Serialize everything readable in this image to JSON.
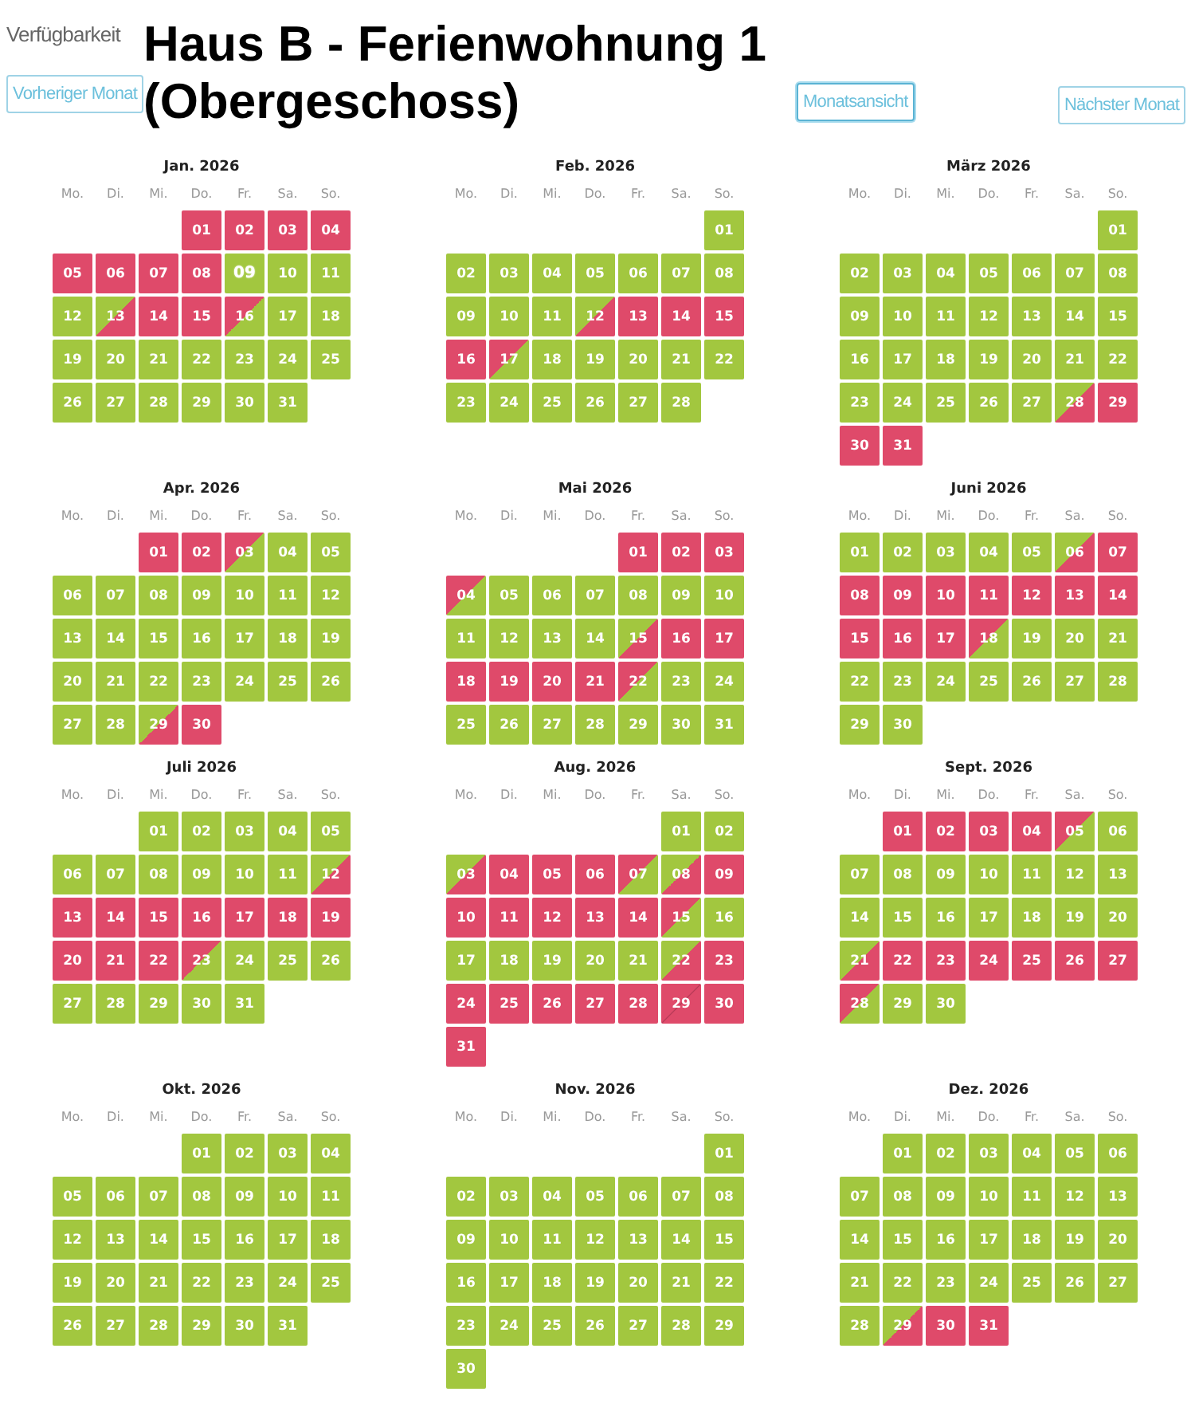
{
  "header": {
    "section_label": "Verfügbarkeit",
    "title": "Haus B - Ferienwohnung 1 (Obergeschoss)",
    "buttons": [
      {
        "label": "Vorheriger Monat",
        "selected": false
      },
      {
        "label": "Monatsansicht",
        "selected": true
      },
      {
        "label": "Nächster Monat",
        "selected": false
      }
    ]
  },
  "months": [
    {
      "title": "Jan. 2026",
      "weekdays": [
        "Mo.",
        "Di.",
        "Mi.",
        "Do.",
        "Fr.",
        "Sa.",
        "So."
      ],
      "cells": [
        null,
        null,
        null,
        {
          "day": "01",
          "kind": "booked",
          "today": false
        },
        {
          "day": "02",
          "kind": "booked",
          "today": false
        },
        {
          "day": "03",
          "kind": "booked",
          "today": false
        },
        {
          "day": "04",
          "kind": "booked",
          "today": false
        },
        {
          "day": "05",
          "kind": "booked",
          "today": false
        },
        {
          "day": "06",
          "kind": "booked",
          "today": false
        },
        {
          "day": "07",
          "kind": "booked",
          "today": false
        },
        {
          "day": "08",
          "kind": "booked",
          "today": false
        },
        {
          "day": "09",
          "kind": "free",
          "today": true
        },
        {
          "day": "10",
          "kind": "free",
          "today": false
        },
        {
          "day": "11",
          "kind": "free",
          "today": false
        },
        {
          "day": "12",
          "kind": "free",
          "today": false
        },
        {
          "day": "13",
          "kind": "arrival",
          "today": false
        },
        {
          "day": "14",
          "kind": "booked",
          "today": false
        },
        {
          "day": "15",
          "kind": "booked",
          "today": false
        },
        {
          "day": "16",
          "kind": "departure",
          "today": false
        },
        {
          "day": "17",
          "kind": "free",
          "today": false
        },
        {
          "day": "18",
          "kind": "free",
          "today": false
        },
        {
          "day": "19",
          "kind": "free",
          "today": false
        },
        {
          "day": "20",
          "kind": "free",
          "today": false
        },
        {
          "day": "21",
          "kind": "free",
          "today": false
        },
        {
          "day": "22",
          "kind": "free",
          "today": false
        },
        {
          "day": "23",
          "kind": "free",
          "today": false
        },
        {
          "day": "24",
          "kind": "free",
          "today": false
        },
        {
          "day": "25",
          "kind": "free",
          "today": false
        },
        {
          "day": "26",
          "kind": "free",
          "today": false
        },
        {
          "day": "27",
          "kind": "free",
          "today": false
        },
        {
          "day": "28",
          "kind": "free",
          "today": false
        },
        {
          "day": "29",
          "kind": "free",
          "today": false
        },
        {
          "day": "30",
          "kind": "free",
          "today": false
        },
        {
          "day": "31",
          "kind": "free",
          "today": false
        }
      ]
    },
    {
      "title": "Feb. 2026",
      "weekdays": [
        "Mo.",
        "Di.",
        "Mi.",
        "Do.",
        "Fr.",
        "Sa.",
        "So."
      ],
      "cells": [
        null,
        null,
        null,
        null,
        null,
        null,
        {
          "day": "01",
          "kind": "free",
          "today": false
        },
        {
          "day": "02",
          "kind": "free",
          "today": false
        },
        {
          "day": "03",
          "kind": "free",
          "today": false
        },
        {
          "day": "04",
          "kind": "free",
          "today": false
        },
        {
          "day": "05",
          "kind": "free",
          "today": false
        },
        {
          "day": "06",
          "kind": "free",
          "today": false
        },
        {
          "day": "07",
          "kind": "free",
          "today": false
        },
        {
          "day": "08",
          "kind": "free",
          "today": false
        },
        {
          "day": "09",
          "kind": "free",
          "today": false
        },
        {
          "day": "10",
          "kind": "free",
          "today": false
        },
        {
          "day": "11",
          "kind": "free",
          "today": false
        },
        {
          "day": "12",
          "kind": "arrival",
          "today": false
        },
        {
          "day": "13",
          "kind": "booked",
          "today": false
        },
        {
          "day": "14",
          "kind": "booked",
          "today": false
        },
        {
          "day": "15",
          "kind": "booked",
          "today": false
        },
        {
          "day": "16",
          "kind": "booked",
          "today": false
        },
        {
          "day": "17",
          "kind": "departure",
          "today": false
        },
        {
          "day": "18",
          "kind": "free",
          "today": false
        },
        {
          "day": "19",
          "kind": "free",
          "today": false
        },
        {
          "day": "20",
          "kind": "free",
          "today": false
        },
        {
          "day": "21",
          "kind": "free",
          "today": false
        },
        {
          "day": "22",
          "kind": "free",
          "today": false
        },
        {
          "day": "23",
          "kind": "free",
          "today": false
        },
        {
          "day": "24",
          "kind": "free",
          "today": false
        },
        {
          "day": "25",
          "kind": "free",
          "today": false
        },
        {
          "day": "26",
          "kind": "free",
          "today": false
        },
        {
          "day": "27",
          "kind": "free",
          "today": false
        },
        {
          "day": "28",
          "kind": "free",
          "today": false
        }
      ]
    },
    {
      "title": "März 2026",
      "weekdays": [
        "Mo.",
        "Di.",
        "Mi.",
        "Do.",
        "Fr.",
        "Sa.",
        "So."
      ],
      "cells": [
        null,
        null,
        null,
        null,
        null,
        null,
        {
          "day": "01",
          "kind": "free",
          "today": false
        },
        {
          "day": "02",
          "kind": "free",
          "today": false
        },
        {
          "day": "03",
          "kind": "free",
          "today": false
        },
        {
          "day": "04",
          "kind": "free",
          "today": false
        },
        {
          "day": "05",
          "kind": "free",
          "today": false
        },
        {
          "day": "06",
          "kind": "free",
          "today": false
        },
        {
          "day": "07",
          "kind": "free",
          "today": false
        },
        {
          "day": "08",
          "kind": "free",
          "today": false
        },
        {
          "day": "09",
          "kind": "free",
          "today": false
        },
        {
          "day": "10",
          "kind": "free",
          "today": false
        },
        {
          "day": "11",
          "kind": "free",
          "today": false
        },
        {
          "day": "12",
          "kind": "free",
          "today": false
        },
        {
          "day": "13",
          "kind": "free",
          "today": false
        },
        {
          "day": "14",
          "kind": "free",
          "today": false
        },
        {
          "day": "15",
          "kind": "free",
          "today": false
        },
        {
          "day": "16",
          "kind": "free",
          "today": false
        },
        {
          "day": "17",
          "kind": "free",
          "today": false
        },
        {
          "day": "18",
          "kind": "free",
          "today": false
        },
        {
          "day": "19",
          "kind": "free",
          "today": false
        },
        {
          "day": "20",
          "kind": "free",
          "today": false
        },
        {
          "day": "21",
          "kind": "free",
          "today": false
        },
        {
          "day": "22",
          "kind": "free",
          "today": false
        },
        {
          "day": "23",
          "kind": "free",
          "today": false
        },
        {
          "day": "24",
          "kind": "free",
          "today": false
        },
        {
          "day": "25",
          "kind": "free",
          "today": false
        },
        {
          "day": "26",
          "kind": "free",
          "today": false
        },
        {
          "day": "27",
          "kind": "free",
          "today": false
        },
        {
          "day": "28",
          "kind": "arrival",
          "today": false
        },
        {
          "day": "29",
          "kind": "booked",
          "today": false
        },
        {
          "day": "30",
          "kind": "booked",
          "today": false
        },
        {
          "day": "31",
          "kind": "booked",
          "today": false
        }
      ]
    },
    {
      "title": "Apr. 2026",
      "weekdays": [
        "Mo.",
        "Di.",
        "Mi.",
        "Do.",
        "Fr.",
        "Sa.",
        "So."
      ],
      "cells": [
        null,
        null,
        {
          "day": "01",
          "kind": "booked",
          "today": false
        },
        {
          "day": "02",
          "kind": "booked",
          "today": false
        },
        {
          "day": "03",
          "kind": "departure",
          "today": false
        },
        {
          "day": "04",
          "kind": "free",
          "today": false
        },
        {
          "day": "05",
          "kind": "free",
          "today": false
        },
        {
          "day": "06",
          "kind": "free",
          "today": false
        },
        {
          "day": "07",
          "kind": "free",
          "today": false
        },
        {
          "day": "08",
          "kind": "free",
          "today": false
        },
        {
          "day": "09",
          "kind": "free",
          "today": false
        },
        {
          "day": "10",
          "kind": "free",
          "today": false
        },
        {
          "day": "11",
          "kind": "free",
          "today": false
        },
        {
          "day": "12",
          "kind": "free",
          "today": false
        },
        {
          "day": "13",
          "kind": "free",
          "today": false
        },
        {
          "day": "14",
          "kind": "free",
          "today": false
        },
        {
          "day": "15",
          "kind": "free",
          "today": false
        },
        {
          "day": "16",
          "kind": "free",
          "today": false
        },
        {
          "day": "17",
          "kind": "free",
          "today": false
        },
        {
          "day": "18",
          "kind": "free",
          "today": false
        },
        {
          "day": "19",
          "kind": "free",
          "today": false
        },
        {
          "day": "20",
          "kind": "free",
          "today": false
        },
        {
          "day": "21",
          "kind": "free",
          "today": false
        },
        {
          "day": "22",
          "kind": "free",
          "today": false
        },
        {
          "day": "23",
          "kind": "free",
          "today": false
        },
        {
          "day": "24",
          "kind": "free",
          "today": false
        },
        {
          "day": "25",
          "kind": "free",
          "today": false
        },
        {
          "day": "26",
          "kind": "free",
          "today": false
        },
        {
          "day": "27",
          "kind": "free",
          "today": false
        },
        {
          "day": "28",
          "kind": "free",
          "today": false
        },
        {
          "day": "29",
          "kind": "arrival",
          "today": false
        },
        {
          "day": "30",
          "kind": "booked",
          "today": false
        }
      ]
    },
    {
      "title": "Mai 2026",
      "weekdays": [
        "Mo.",
        "Di.",
        "Mi.",
        "Do.",
        "Fr.",
        "Sa.",
        "So."
      ],
      "cells": [
        null,
        null,
        null,
        null,
        {
          "day": "01",
          "kind": "booked",
          "today": false
        },
        {
          "day": "02",
          "kind": "booked",
          "today": false
        },
        {
          "day": "03",
          "kind": "booked",
          "today": false
        },
        {
          "day": "04",
          "kind": "departure",
          "today": false
        },
        {
          "day": "05",
          "kind": "free",
          "today": false
        },
        {
          "day": "06",
          "kind": "free",
          "today": false
        },
        {
          "day": "07",
          "kind": "free",
          "today": false
        },
        {
          "day": "08",
          "kind": "free",
          "today": false
        },
        {
          "day": "09",
          "kind": "free",
          "today": false
        },
        {
          "day": "10",
          "kind": "free",
          "today": false
        },
        {
          "day": "11",
          "kind": "free",
          "today": false
        },
        {
          "day": "12",
          "kind": "free",
          "today": false
        },
        {
          "day": "13",
          "kind": "free",
          "today": false
        },
        {
          "day": "14",
          "kind": "free",
          "today": false
        },
        {
          "day": "15",
          "kind": "arrival",
          "today": false
        },
        {
          "day": "16",
          "kind": "booked",
          "today": false
        },
        {
          "day": "17",
          "kind": "booked",
          "today": false
        },
        {
          "day": "18",
          "kind": "booked",
          "today": false
        },
        {
          "day": "19",
          "kind": "booked",
          "today": false
        },
        {
          "day": "20",
          "kind": "booked",
          "today": false
        },
        {
          "day": "21",
          "kind": "booked",
          "today": false
        },
        {
          "day": "22",
          "kind": "departure",
          "today": false
        },
        {
          "day": "23",
          "kind": "free",
          "today": false
        },
        {
          "day": "24",
          "kind": "free",
          "today": false
        },
        {
          "day": "25",
          "kind": "free",
          "today": false
        },
        {
          "day": "26",
          "kind": "free",
          "today": false
        },
        {
          "day": "27",
          "kind": "free",
          "today": false
        },
        {
          "day": "28",
          "kind": "free",
          "today": false
        },
        {
          "day": "29",
          "kind": "free",
          "today": false
        },
        {
          "day": "30",
          "kind": "free",
          "today": false
        },
        {
          "day": "31",
          "kind": "free",
          "today": false
        }
      ]
    },
    {
      "title": "Juni 2026",
      "weekdays": [
        "Mo.",
        "Di.",
        "Mi.",
        "Do.",
        "Fr.",
        "Sa.",
        "So."
      ],
      "cells": [
        {
          "day": "01",
          "kind": "free",
          "today": false
        },
        {
          "day": "02",
          "kind": "free",
          "today": false
        },
        {
          "day": "03",
          "kind": "free",
          "today": false
        },
        {
          "day": "04",
          "kind": "free",
          "today": false
        },
        {
          "day": "05",
          "kind": "free",
          "today": false
        },
        {
          "day": "06",
          "kind": "arrival",
          "today": false
        },
        {
          "day": "07",
          "kind": "booked",
          "today": false
        },
        {
          "day": "08",
          "kind": "booked",
          "today": false
        },
        {
          "day": "09",
          "kind": "booked",
          "today": false
        },
        {
          "day": "10",
          "kind": "booked",
          "today": false
        },
        {
          "day": "11",
          "kind": "booked",
          "today": false
        },
        {
          "day": "12",
          "kind": "booked",
          "today": false
        },
        {
          "day": "13",
          "kind": "booked",
          "today": false
        },
        {
          "day": "14",
          "kind": "booked",
          "today": false
        },
        {
          "day": "15",
          "kind": "booked",
          "today": false
        },
        {
          "day": "16",
          "kind": "booked",
          "today": false
        },
        {
          "day": "17",
          "kind": "booked",
          "today": false
        },
        {
          "day": "18",
          "kind": "departure",
          "today": false
        },
        {
          "day": "19",
          "kind": "free",
          "today": false
        },
        {
          "day": "20",
          "kind": "free",
          "today": false
        },
        {
          "day": "21",
          "kind": "free",
          "today": false
        },
        {
          "day": "22",
          "kind": "free",
          "today": false
        },
        {
          "day": "23",
          "kind": "free",
          "today": false
        },
        {
          "day": "24",
          "kind": "free",
          "today": false
        },
        {
          "day": "25",
          "kind": "free",
          "today": false
        },
        {
          "day": "26",
          "kind": "free",
          "today": false
        },
        {
          "day": "27",
          "kind": "free",
          "today": false
        },
        {
          "day": "28",
          "kind": "free",
          "today": false
        },
        {
          "day": "29",
          "kind": "free",
          "today": false
        },
        {
          "day": "30",
          "kind": "free",
          "today": false
        }
      ]
    },
    {
      "title": "Juli 2026",
      "weekdays": [
        "Mo.",
        "Di.",
        "Mi.",
        "Do.",
        "Fr.",
        "Sa.",
        "So."
      ],
      "cells": [
        null,
        null,
        {
          "day": "01",
          "kind": "free",
          "today": false
        },
        {
          "day": "02",
          "kind": "free",
          "today": false
        },
        {
          "day": "03",
          "kind": "free",
          "today": false
        },
        {
          "day": "04",
          "kind": "free",
          "today": false
        },
        {
          "day": "05",
          "kind": "free",
          "today": false
        },
        {
          "day": "06",
          "kind": "free",
          "today": false
        },
        {
          "day": "07",
          "kind": "free",
          "today": false
        },
        {
          "day": "08",
          "kind": "free",
          "today": false
        },
        {
          "day": "09",
          "kind": "free",
          "today": false
        },
        {
          "day": "10",
          "kind": "free",
          "today": false
        },
        {
          "day": "11",
          "kind": "free",
          "today": false
        },
        {
          "day": "12",
          "kind": "arrival",
          "today": false
        },
        {
          "day": "13",
          "kind": "booked",
          "today": false
        },
        {
          "day": "14",
          "kind": "booked",
          "today": false
        },
        {
          "day": "15",
          "kind": "booked",
          "today": false
        },
        {
          "day": "16",
          "kind": "booked",
          "today": false
        },
        {
          "day": "17",
          "kind": "booked",
          "today": false
        },
        {
          "day": "18",
          "kind": "booked",
          "today": false
        },
        {
          "day": "19",
          "kind": "booked",
          "today": false
        },
        {
          "day": "20",
          "kind": "booked",
          "today": false
        },
        {
          "day": "21",
          "kind": "booked",
          "today": false
        },
        {
          "day": "22",
          "kind": "booked",
          "today": false
        },
        {
          "day": "23",
          "kind": "departure",
          "today": false
        },
        {
          "day": "24",
          "kind": "free",
          "today": false
        },
        {
          "day": "25",
          "kind": "free",
          "today": false
        },
        {
          "day": "26",
          "kind": "free",
          "today": false
        },
        {
          "day": "27",
          "kind": "free",
          "today": false
        },
        {
          "day": "28",
          "kind": "free",
          "today": false
        },
        {
          "day": "29",
          "kind": "free",
          "today": false
        },
        {
          "day": "30",
          "kind": "free",
          "today": false
        },
        {
          "day": "31",
          "kind": "free",
          "today": false
        }
      ]
    },
    {
      "title": "Aug. 2026",
      "weekdays": [
        "Mo.",
        "Di.",
        "Mi.",
        "Do.",
        "Fr.",
        "Sa.",
        "So."
      ],
      "cells": [
        null,
        null,
        null,
        null,
        null,
        {
          "day": "01",
          "kind": "free",
          "today": false
        },
        {
          "day": "02",
          "kind": "free",
          "today": false
        },
        {
          "day": "03",
          "kind": "arrival",
          "today": false
        },
        {
          "day": "04",
          "kind": "booked",
          "today": false
        },
        {
          "day": "05",
          "kind": "booked",
          "today": false
        },
        {
          "day": "06",
          "kind": "booked",
          "today": false
        },
        {
          "day": "07",
          "kind": "departure",
          "today": false
        },
        {
          "day": "08",
          "kind": "arrival",
          "today": false
        },
        {
          "day": "09",
          "kind": "booked",
          "today": false
        },
        {
          "day": "10",
          "kind": "booked",
          "today": false
        },
        {
          "day": "11",
          "kind": "booked",
          "today": false
        },
        {
          "day": "12",
          "kind": "booked",
          "today": false
        },
        {
          "day": "13",
          "kind": "booked",
          "today": false
        },
        {
          "day": "14",
          "kind": "booked",
          "today": false
        },
        {
          "day": "15",
          "kind": "departure",
          "today": false
        },
        {
          "day": "16",
          "kind": "free",
          "today": false
        },
        {
          "day": "17",
          "kind": "free",
          "today": false
        },
        {
          "day": "18",
          "kind": "free",
          "today": false
        },
        {
          "day": "19",
          "kind": "free",
          "today": false
        },
        {
          "day": "20",
          "kind": "free",
          "today": false
        },
        {
          "day": "21",
          "kind": "free",
          "today": false
        },
        {
          "day": "22",
          "kind": "arrival",
          "today": false
        },
        {
          "day": "23",
          "kind": "booked",
          "today": false
        },
        {
          "day": "24",
          "kind": "booked",
          "today": false
        },
        {
          "day": "25",
          "kind": "booked",
          "today": false
        },
        {
          "day": "26",
          "kind": "booked",
          "today": false
        },
        {
          "day": "27",
          "kind": "booked",
          "today": false
        },
        {
          "day": "28",
          "kind": "booked",
          "today": false
        },
        {
          "day": "29",
          "kind": "changeover",
          "today": false
        },
        {
          "day": "30",
          "kind": "booked",
          "today": false
        },
        {
          "day": "31",
          "kind": "booked",
          "today": false
        }
      ]
    },
    {
      "title": "Sept. 2026",
      "weekdays": [
        "Mo.",
        "Di.",
        "Mi.",
        "Do.",
        "Fr.",
        "Sa.",
        "So."
      ],
      "cells": [
        null,
        {
          "day": "01",
          "kind": "booked",
          "today": false
        },
        {
          "day": "02",
          "kind": "booked",
          "today": false
        },
        {
          "day": "03",
          "kind": "booked",
          "today": false
        },
        {
          "day": "04",
          "kind": "booked",
          "today": false
        },
        {
          "day": "05",
          "kind": "departure",
          "today": false
        },
        {
          "day": "06",
          "kind": "free",
          "today": false
        },
        {
          "day": "07",
          "kind": "free",
          "today": false
        },
        {
          "day": "08",
          "kind": "free",
          "today": false
        },
        {
          "day": "09",
          "kind": "free",
          "today": false
        },
        {
          "day": "10",
          "kind": "free",
          "today": false
        },
        {
          "day": "11",
          "kind": "free",
          "today": false
        },
        {
          "day": "12",
          "kind": "free",
          "today": false
        },
        {
          "day": "13",
          "kind": "free",
          "today": false
        },
        {
          "day": "14",
          "kind": "free",
          "today": false
        },
        {
          "day": "15",
          "kind": "free",
          "today": false
        },
        {
          "day": "16",
          "kind": "free",
          "today": false
        },
        {
          "day": "17",
          "kind": "free",
          "today": false
        },
        {
          "day": "18",
          "kind": "free",
          "today": false
        },
        {
          "day": "19",
          "kind": "free",
          "today": false
        },
        {
          "day": "20",
          "kind": "free",
          "today": false
        },
        {
          "day": "21",
          "kind": "arrival",
          "today": false
        },
        {
          "day": "22",
          "kind": "booked",
          "today": false
        },
        {
          "day": "23",
          "kind": "booked",
          "today": false
        },
        {
          "day": "24",
          "kind": "booked",
          "today": false
        },
        {
          "day": "25",
          "kind": "booked",
          "today": false
        },
        {
          "day": "26",
          "kind": "booked",
          "today": false
        },
        {
          "day": "27",
          "kind": "booked",
          "today": false
        },
        {
          "day": "28",
          "kind": "departure",
          "today": false
        },
        {
          "day": "29",
          "kind": "free",
          "today": false
        },
        {
          "day": "30",
          "kind": "free",
          "today": false
        }
      ]
    },
    {
      "title": "Okt. 2026",
      "weekdays": [
        "Mo.",
        "Di.",
        "Mi.",
        "Do.",
        "Fr.",
        "Sa.",
        "So."
      ],
      "cells": [
        null,
        null,
        null,
        {
          "day": "01",
          "kind": "free",
          "today": false
        },
        {
          "day": "02",
          "kind": "free",
          "today": false
        },
        {
          "day": "03",
          "kind": "free",
          "today": false
        },
        {
          "day": "04",
          "kind": "free",
          "today": false
        },
        {
          "day": "05",
          "kind": "free",
          "today": false
        },
        {
          "day": "06",
          "kind": "free",
          "today": false
        },
        {
          "day": "07",
          "kind": "free",
          "today": false
        },
        {
          "day": "08",
          "kind": "free",
          "today": false
        },
        {
          "day": "09",
          "kind": "free",
          "today": false
        },
        {
          "day": "10",
          "kind": "free",
          "today": false
        },
        {
          "day": "11",
          "kind": "free",
          "today": false
        },
        {
          "day": "12",
          "kind": "free",
          "today": false
        },
        {
          "day": "13",
          "kind": "free",
          "today": false
        },
        {
          "day": "14",
          "kind": "free",
          "today": false
        },
        {
          "day": "15",
          "kind": "free",
          "today": false
        },
        {
          "day": "16",
          "kind": "free",
          "today": false
        },
        {
          "day": "17",
          "kind": "free",
          "today": false
        },
        {
          "day": "18",
          "kind": "free",
          "today": false
        },
        {
          "day": "19",
          "kind": "free",
          "today": false
        },
        {
          "day": "20",
          "kind": "free",
          "today": false
        },
        {
          "day": "21",
          "kind": "free",
          "today": false
        },
        {
          "day": "22",
          "kind": "free",
          "today": false
        },
        {
          "day": "23",
          "kind": "free",
          "today": false
        },
        {
          "day": "24",
          "kind": "free",
          "today": false
        },
        {
          "day": "25",
          "kind": "free",
          "today": false
        },
        {
          "day": "26",
          "kind": "free",
          "today": false
        },
        {
          "day": "27",
          "kind": "free",
          "today": false
        },
        {
          "day": "28",
          "kind": "free",
          "today": false
        },
        {
          "day": "29",
          "kind": "free",
          "today": false
        },
        {
          "day": "30",
          "kind": "free",
          "today": false
        },
        {
          "day": "31",
          "kind": "free",
          "today": false
        }
      ]
    },
    {
      "title": "Nov. 2026",
      "weekdays": [
        "Mo.",
        "Di.",
        "Mi.",
        "Do.",
        "Fr.",
        "Sa.",
        "So."
      ],
      "cells": [
        null,
        null,
        null,
        null,
        null,
        null,
        {
          "day": "01",
          "kind": "free",
          "today": false
        },
        {
          "day": "02",
          "kind": "free",
          "today": false
        },
        {
          "day": "03",
          "kind": "free",
          "today": false
        },
        {
          "day": "04",
          "kind": "free",
          "today": false
        },
        {
          "day": "05",
          "kind": "free",
          "today": false
        },
        {
          "day": "06",
          "kind": "free",
          "today": false
        },
        {
          "day": "07",
          "kind": "free",
          "today": false
        },
        {
          "day": "08",
          "kind": "free",
          "today": false
        },
        {
          "day": "09",
          "kind": "free",
          "today": false
        },
        {
          "day": "10",
          "kind": "free",
          "today": false
        },
        {
          "day": "11",
          "kind": "free",
          "today": false
        },
        {
          "day": "12",
          "kind": "free",
          "today": false
        },
        {
          "day": "13",
          "kind": "free",
          "today": false
        },
        {
          "day": "14",
          "kind": "free",
          "today": false
        },
        {
          "day": "15",
          "kind": "free",
          "today": false
        },
        {
          "day": "16",
          "kind": "free",
          "today": false
        },
        {
          "day": "17",
          "kind": "free",
          "today": false
        },
        {
          "day": "18",
          "kind": "free",
          "today": false
        },
        {
          "day": "19",
          "kind": "free",
          "today": false
        },
        {
          "day": "20",
          "kind": "free",
          "today": false
        },
        {
          "day": "21",
          "kind": "free",
          "today": false
        },
        {
          "day": "22",
          "kind": "free",
          "today": false
        },
        {
          "day": "23",
          "kind": "free",
          "today": false
        },
        {
          "day": "24",
          "kind": "free",
          "today": false
        },
        {
          "day": "25",
          "kind": "free",
          "today": false
        },
        {
          "day": "26",
          "kind": "free",
          "today": false
        },
        {
          "day": "27",
          "kind": "free",
          "today": false
        },
        {
          "day": "28",
          "kind": "free",
          "today": false
        },
        {
          "day": "29",
          "kind": "free",
          "today": false
        },
        {
          "day": "30",
          "kind": "free",
          "today": false
        }
      ]
    },
    {
      "title": "Dez. 2026",
      "weekdays": [
        "Mo.",
        "Di.",
        "Mi.",
        "Do.",
        "Fr.",
        "Sa.",
        "So."
      ],
      "cells": [
        null,
        {
          "day": "01",
          "kind": "free",
          "today": false
        },
        {
          "day": "02",
          "kind": "free",
          "today": false
        },
        {
          "day": "03",
          "kind": "free",
          "today": false
        },
        {
          "day": "04",
          "kind": "free",
          "today": false
        },
        {
          "day": "05",
          "kind": "free",
          "today": false
        },
        {
          "day": "06",
          "kind": "free",
          "today": false
        },
        {
          "day": "07",
          "kind": "free",
          "today": false
        },
        {
          "day": "08",
          "kind": "free",
          "today": false
        },
        {
          "day": "09",
          "kind": "free",
          "today": false
        },
        {
          "day": "10",
          "kind": "free",
          "today": false
        },
        {
          "day": "11",
          "kind": "free",
          "today": false
        },
        {
          "day": "12",
          "kind": "free",
          "today": false
        },
        {
          "day": "13",
          "kind": "free",
          "today": false
        },
        {
          "day": "14",
          "kind": "free",
          "today": false
        },
        {
          "day": "15",
          "kind": "free",
          "today": false
        },
        {
          "day": "16",
          "kind": "free",
          "today": false
        },
        {
          "day": "17",
          "kind": "free",
          "today": false
        },
        {
          "day": "18",
          "kind": "free",
          "today": false
        },
        {
          "day": "19",
          "kind": "free",
          "today": false
        },
        {
          "day": "20",
          "kind": "free",
          "today": false
        },
        {
          "day": "21",
          "kind": "free",
          "today": false
        },
        {
          "day": "22",
          "kind": "free",
          "today": false
        },
        {
          "day": "23",
          "kind": "free",
          "today": false
        },
        {
          "day": "24",
          "kind": "free",
          "today": false
        },
        {
          "day": "25",
          "kind": "free",
          "today": false
        },
        {
          "day": "26",
          "kind": "free",
          "today": false
        },
        {
          "day": "27",
          "kind": "free",
          "today": false
        },
        {
          "day": "28",
          "kind": "free",
          "today": false
        },
        {
          "day": "29",
          "kind": "arrival",
          "today": false
        },
        {
          "day": "30",
          "kind": "booked",
          "today": false
        },
        {
          "day": "31",
          "kind": "booked",
          "today": false
        }
      ]
    }
  ]
}
